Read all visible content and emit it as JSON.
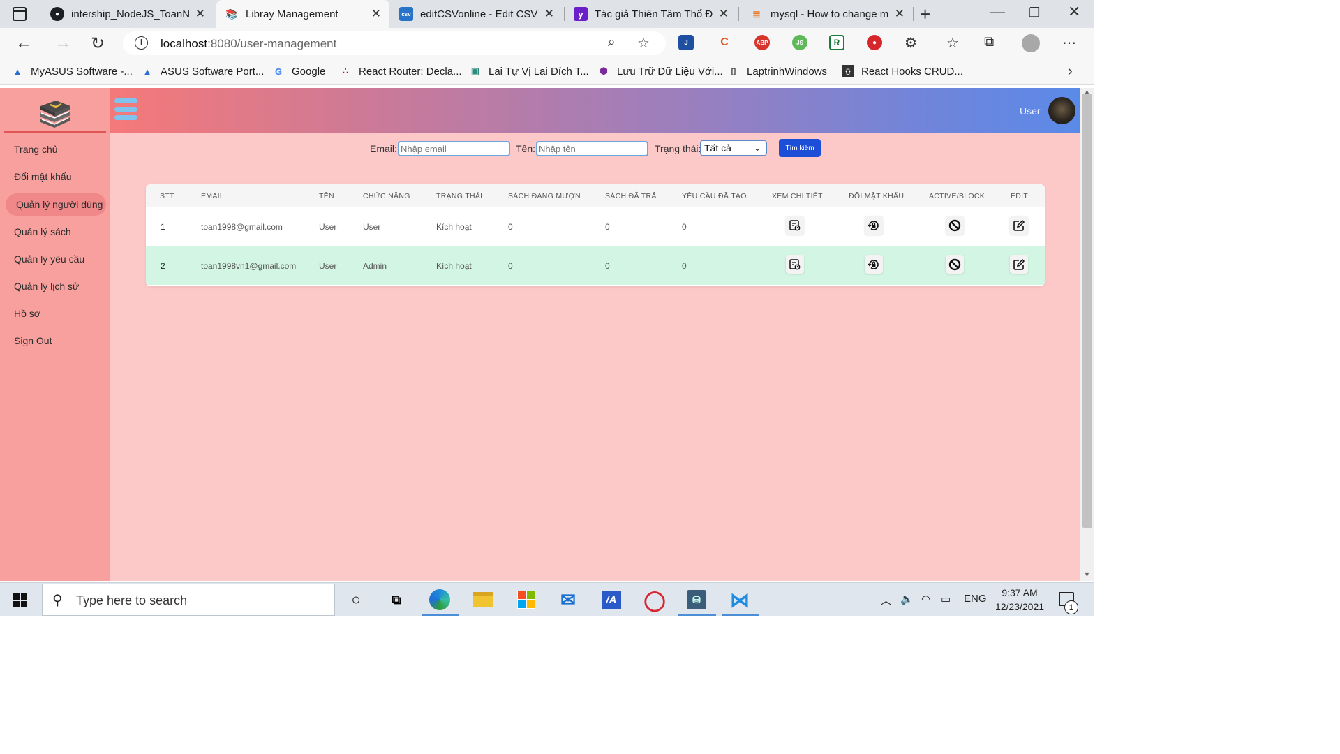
{
  "browser": {
    "tabs": [
      {
        "title": "intership_NodeJS_ToanNT",
        "icon": "github-icon"
      },
      {
        "title": "Libray Management",
        "icon": "books-icon"
      },
      {
        "title": "editCSVonline - Edit CSV f",
        "icon": "csv-icon"
      },
      {
        "title": "Tác giả Thiên Tâm Thổ Đậ",
        "icon": "yahoo-icon"
      },
      {
        "title": "mysql - How to change m",
        "icon": "stackoverflow-icon"
      }
    ],
    "active_tab_index": 1,
    "url_host": "localhost",
    "url_path": ":8080/user-management",
    "bookmarks": [
      {
        "label": "MyASUS Software -...",
        "icon": "asus-icon"
      },
      {
        "label": "ASUS Software Port...",
        "icon": "asus-icon"
      },
      {
        "label": "Google",
        "icon": "google-icon"
      },
      {
        "label": "React Router: Decla...",
        "icon": "react-router-icon"
      },
      {
        "label": "Lai Tự Vị Lai Đích T...",
        "icon": "book-icon"
      },
      {
        "label": "Lưu Trữ Dữ Liệu Với...",
        "icon": "hexagon-icon"
      },
      {
        "label": "LaptrinhWindows",
        "icon": "page-icon"
      },
      {
        "label": "React Hooks CRUD...",
        "icon": "code-icon"
      }
    ]
  },
  "app": {
    "sidebar": {
      "items": [
        {
          "label": "Trang chủ"
        },
        {
          "label": "Đổi mật khẩu"
        },
        {
          "label": "Quản lý người dùng"
        },
        {
          "label": "Quản lý sách"
        },
        {
          "label": "Quản lý yêu cầu"
        },
        {
          "label": "Quản lý lịch sử"
        },
        {
          "label": "Hồ sơ"
        },
        {
          "label": "Sign Out"
        }
      ],
      "active_index": 2
    },
    "header": {
      "user_label": "User"
    },
    "filters": {
      "email_label": "Email:",
      "email_placeholder": "Nhập email",
      "name_label": "Tên:",
      "name_placeholder": "Nhập tên",
      "status_label": "Trạng thái:",
      "status_value": "Tất cả",
      "search_label": "Tìm kiếm"
    },
    "table": {
      "headers": [
        "STT",
        "EMAIL",
        "TÊN",
        "CHỨC NĂNG",
        "TRẠNG THÁI",
        "SÁCH ĐANG MƯỢN",
        "SÁCH ĐÃ TRẢ",
        "YÊU CẦU ĐÃ TẠO",
        "XEM CHI TIẾT",
        "ĐỔI MẬT KHẨU",
        "ACTIVE/BLOCK",
        "EDIT"
      ],
      "rows": [
        {
          "stt": "1",
          "email": "toan1998@gmail.com",
          "name": "User",
          "role": "User",
          "status": "Kích hoạt",
          "borrowing": "0",
          "returned": "0",
          "requests": "0"
        },
        {
          "stt": "2",
          "email": "toan1998vn1@gmail.com",
          "name": "User",
          "role": "Admin",
          "status": "Kích hoạt",
          "borrowing": "0",
          "returned": "0",
          "requests": "0"
        }
      ]
    },
    "colors": {
      "sidebar_bg": "#f8a09e",
      "content_bg": "#fdc8c8",
      "search_button": "#1c4ed8",
      "highlight_row": "#d3f5e4"
    }
  },
  "taskbar": {
    "search_placeholder": "Type here to search",
    "language": "ENG",
    "time": "9:37 AM",
    "date": "12/23/2021",
    "notification_count": "1"
  }
}
